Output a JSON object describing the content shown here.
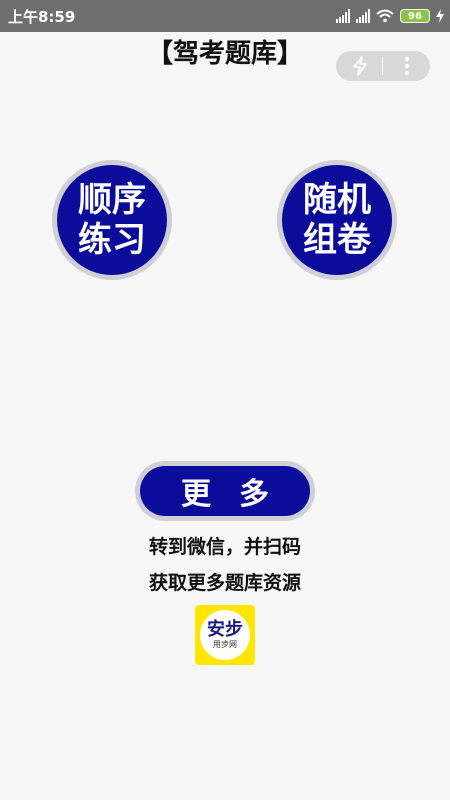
{
  "status_bar": {
    "time": "上午8:59",
    "battery": "96",
    "bg_color": "#6f6f6f"
  },
  "header": {
    "title": "【驾考题库】"
  },
  "buttons": {
    "sequential_line1": "顺序",
    "sequential_line2": "练习",
    "random_line1": "随机",
    "random_line2": "组卷",
    "more": "更多"
  },
  "hints": {
    "line1": "转到微信，并扫码",
    "line2": "获取更多题库资源"
  },
  "logo": {
    "brand": "安步",
    "sub": "用步网"
  },
  "colors": {
    "button_fill": "#0c0c9a",
    "button_ring": "#cfcfd8",
    "logo_bg": "#ffe600"
  }
}
